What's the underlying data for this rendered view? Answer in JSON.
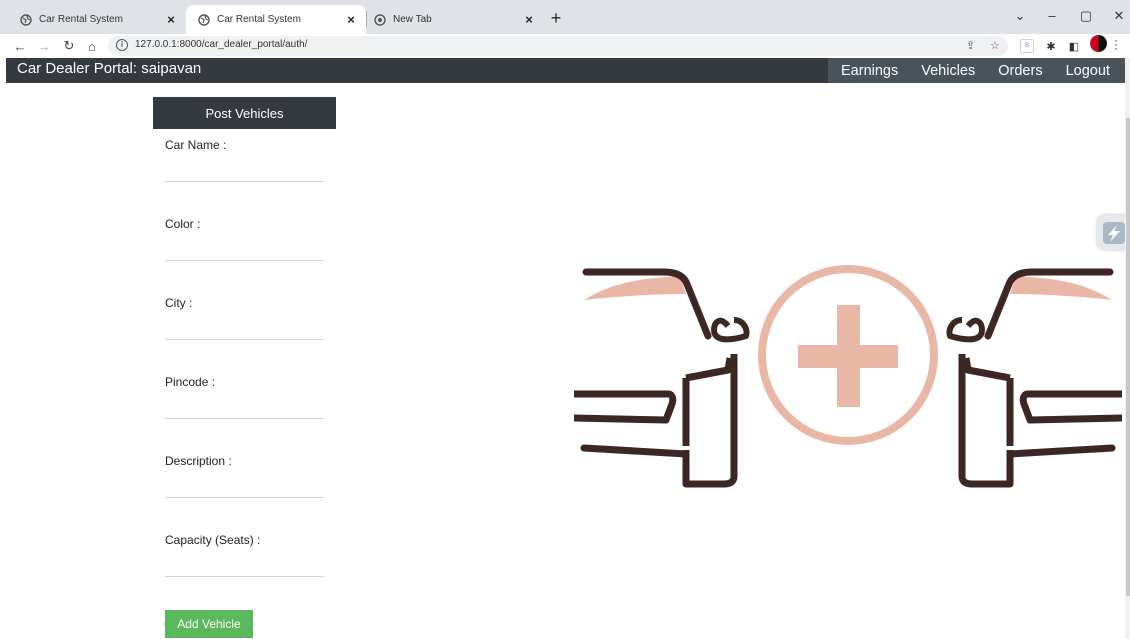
{
  "browser": {
    "tabs": [
      {
        "title": "Car Rental System",
        "active": false
      },
      {
        "title": "Car Rental System",
        "active": true
      },
      {
        "title": "New Tab",
        "active": false
      }
    ],
    "url": "127.0.0.1:8000/car_dealer_portal/auth/",
    "extension_badge": "B"
  },
  "navbar": {
    "brand": "Car Dealer Portal: saipavan",
    "links": [
      "Earnings",
      "Vehicles",
      "Orders",
      "Logout"
    ],
    "color": "#343a40"
  },
  "form": {
    "title": "Post Vehicles",
    "fields": [
      {
        "label": "Car Name :",
        "value": ""
      },
      {
        "label": "Color :",
        "value": ""
      },
      {
        "label": "City :",
        "value": ""
      },
      {
        "label": "Pincode :",
        "value": ""
      },
      {
        "label": "Description :",
        "value": ""
      },
      {
        "label": "Capacity (Seats) :",
        "value": ""
      }
    ],
    "submit_label": "Add Vehicle",
    "submit_color": "#5cb85c"
  },
  "illustration": {
    "icon": "car-plus-icon",
    "line_color": "#3d2723",
    "accent_color": "#e8b7a6"
  }
}
